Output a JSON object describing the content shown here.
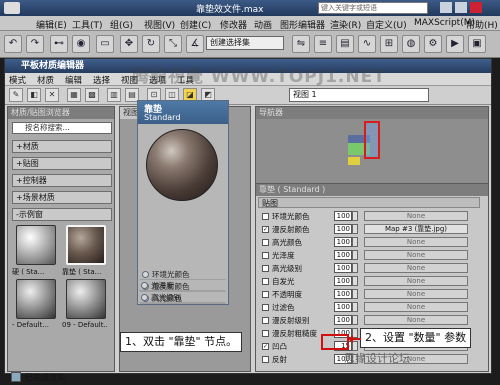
{
  "max_window": {
    "title": "靠垫效文件.max",
    "search_placeholder": "键入关键字或短语",
    "menu": [
      "编辑(E)",
      "工具(T)",
      "组(G)",
      "视图(V)",
      "创建(C)",
      "修改器",
      "动画",
      "图形编辑器",
      "渲染(R)",
      "自定义(U)",
      "MAXScript(M)",
      "帮助(H)"
    ],
    "selection_dropdown": "创建选择集"
  },
  "editor": {
    "title": "平板材质编辑器",
    "menu": [
      "模式",
      "材质",
      "编辑",
      "选择",
      "视图",
      "选项",
      "工具"
    ],
    "view_select": "视图 1",
    "browser": {
      "header": "材质/贴图浏览器",
      "search_placeholder": "按名称搜索...",
      "categories": [
        "+材质",
        "+贴图",
        "+控制器",
        "+场景材质",
        "-示例窗"
      ],
      "thumbs": [
        {
          "label": "硬 ( Sta..."
        },
        {
          "label": "靠垫 ( Sta..."
        },
        {
          "label": "- Default..."
        },
        {
          "label": "09 - Default..."
        }
      ]
    },
    "view_tab": "视图 1",
    "navigator_header": "导航器",
    "watermark": "腾龍視覺 WWW.TOPJ1.NET",
    "node": {
      "name": "靠垫",
      "type": "Standard",
      "slots": [
        "环境光颜色",
        "漫反射颜色",
        "高光颜色",
        "光泽度",
        "高光级别",
        "不透明度",
        "凹凸"
      ]
    },
    "params": {
      "header": "靠垫 ( Standard )",
      "subheader": "贴图",
      "rows": [
        {
          "label": "环境光颜色",
          "value": "100",
          "map": "None",
          "checked": false
        },
        {
          "label": "漫反射颜色",
          "value": "100",
          "map": "Map #3 (靠垫.jpg)",
          "checked": true
        },
        {
          "label": "高光颜色",
          "value": "100",
          "map": "None",
          "checked": false
        },
        {
          "label": "光泽度",
          "value": "100",
          "map": "None",
          "checked": false
        },
        {
          "label": "高光级别",
          "value": "100",
          "map": "None",
          "checked": false
        },
        {
          "label": "自发光",
          "value": "100",
          "map": "None",
          "checked": false
        },
        {
          "label": "不透明度",
          "value": "100",
          "map": "None",
          "checked": false
        },
        {
          "label": "过滤色",
          "value": "100",
          "map": "None",
          "checked": false
        },
        {
          "label": "漫反射级别",
          "value": "100",
          "map": "None",
          "checked": false
        },
        {
          "label": "漫反射粗糙度",
          "value": "100",
          "map": "None",
          "checked": false
        },
        {
          "label": "凹凸",
          "value": "15",
          "map": "None",
          "checked": true
        },
        {
          "label": "反射",
          "value": "100",
          "map": "None",
          "checked": false
        }
      ]
    },
    "status": "已完成渲染"
  },
  "callouts": {
    "step1": "1、双击 \"靠垫\" 节点。",
    "step2": "2、设置 \"数量\" 参数",
    "site": "思缘设计论坛"
  }
}
